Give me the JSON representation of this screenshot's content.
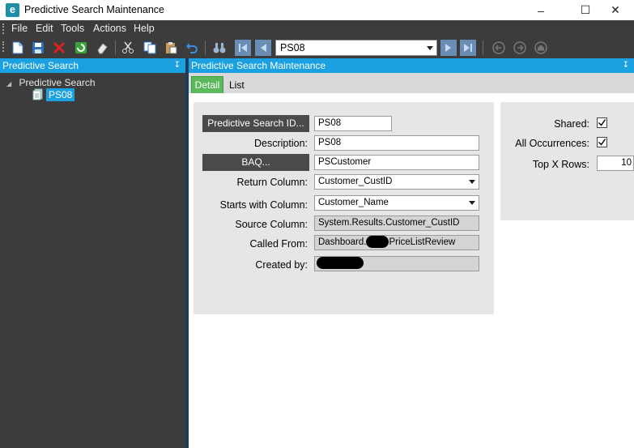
{
  "window": {
    "title": "Predictive Search Maintenance",
    "logo_letter": "e",
    "minimize": "–",
    "maximize": "☐",
    "close": "✕"
  },
  "menu": [
    "File",
    "Edit",
    "Tools",
    "Actions",
    "Help"
  ],
  "toolbar": {
    "search_value": "PS08"
  },
  "left_panel": {
    "header": "Predictive Search",
    "pin": "↧",
    "tree_root": "Predictive Search",
    "tree_expander": "◢",
    "tree_child": "PS08"
  },
  "right_panel": {
    "header": "Predictive Search Maintenance",
    "pin": "↧",
    "tabs": [
      "Detail",
      "List"
    ]
  },
  "form": {
    "ps_id_button": "Predictive Search ID...",
    "ps_id_value": "PS08",
    "description_label": "Description:",
    "description_value": "PS08",
    "baq_button": "BAQ...",
    "baq_value": "PSCustomer",
    "return_column_label": "Return Column:",
    "return_column_value": "Customer_CustID",
    "starts_with_label": "Starts with Column:",
    "starts_with_value": "Customer_Name",
    "source_column_label": "Source Column:",
    "source_column_value": "System.Results.Customer_CustID",
    "called_from_label": "Called From:",
    "called_from_prefix": "Dashboard.",
    "called_from_suffix": "PriceListReview",
    "created_by_label": "Created by:"
  },
  "side": {
    "shared_label": "Shared:",
    "shared_checked": true,
    "all_occ_label": "All Occurrences:",
    "all_occ_checked": true,
    "topx_label": "Top X Rows:",
    "topx_value": "10"
  },
  "colors": {
    "accent": "#1ba1e2",
    "dark_bar": "#3c3c3c",
    "active_tab": "#5cb85c"
  }
}
